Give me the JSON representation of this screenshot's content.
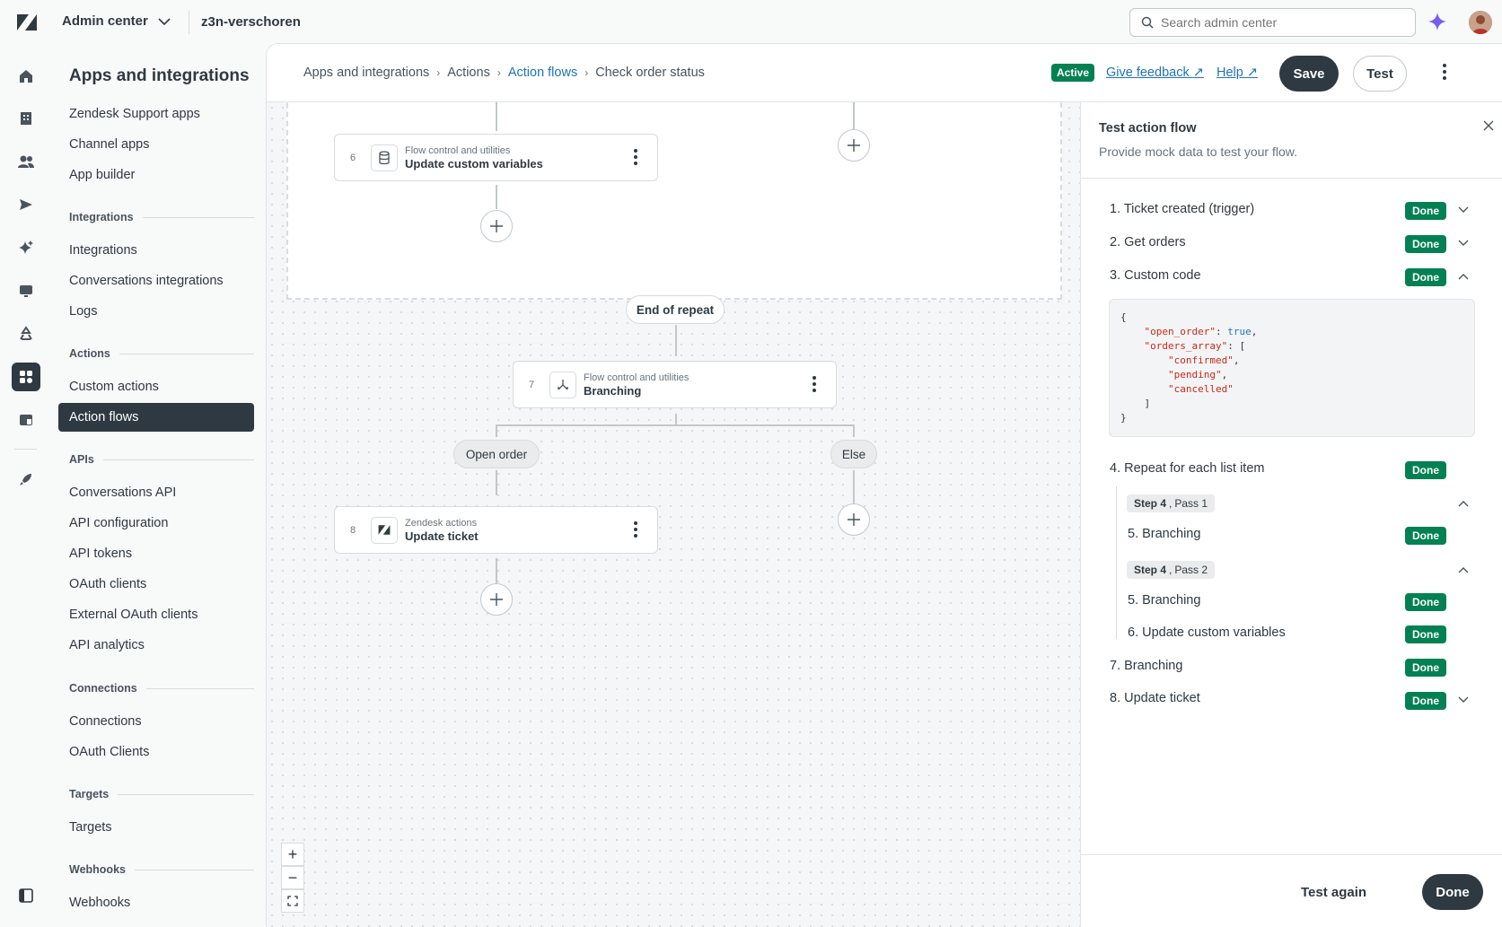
{
  "topbar": {
    "product": "Admin center",
    "account": "z3n-verschoren",
    "search_placeholder": "Search admin center"
  },
  "rail": {
    "icons": [
      "home-icon",
      "building-icon",
      "people-icon",
      "send-icon",
      "sparkle-icon",
      "monitor-icon",
      "recycle-icon",
      "apps-icon",
      "objects-icon",
      "rocket-icon",
      "sidebar-toggle-icon"
    ]
  },
  "sidebar": {
    "title": "Apps and integrations",
    "items_top": [
      "Zendesk Support apps",
      "Channel apps",
      "App builder"
    ],
    "groups": [
      {
        "label": "Integrations",
        "items": [
          "Integrations",
          "Conversations integrations",
          "Logs"
        ]
      },
      {
        "label": "Actions",
        "items": [
          "Custom actions",
          "Action flows"
        ]
      },
      {
        "label": "APIs",
        "items": [
          "Conversations API",
          "API configuration",
          "API tokens",
          "OAuth clients",
          "External OAuth clients",
          "API analytics"
        ]
      },
      {
        "label": "Connections",
        "items": [
          "Connections",
          "OAuth Clients"
        ]
      },
      {
        "label": "Targets",
        "items": [
          "Targets"
        ]
      },
      {
        "label": "Webhooks",
        "items": [
          "Webhooks"
        ]
      }
    ],
    "active_item": "Action flows"
  },
  "header": {
    "breadcrumb": [
      "Apps and integrations",
      "Actions",
      "Action flows",
      "Check order status"
    ],
    "status": "Active",
    "feedback": "Give feedback",
    "help": "Help",
    "save": "Save",
    "test": "Test"
  },
  "canvas": {
    "nodes": [
      {
        "num": "6",
        "category": "Flow control and utilities",
        "name": "Update custom variables",
        "icon": "database-icon"
      },
      {
        "num": "7",
        "category": "Flow control and utilities",
        "name": "Branching",
        "icon": "branch-icon"
      },
      {
        "num": "8",
        "category": "Zendesk actions",
        "name": "Update ticket",
        "icon": "zendesk-icon"
      }
    ],
    "end_repeat": "End of repeat",
    "branch_open": "Open order",
    "branch_else": "Else",
    "zoom": [
      "+",
      "−"
    ]
  },
  "test_panel": {
    "title": "Test action flow",
    "subtitle": "Provide mock data to test your flow.",
    "steps": [
      {
        "label": "1. Ticket created (trigger)",
        "status": "Done",
        "chevron": "down"
      },
      {
        "label": "2. Get orders",
        "status": "Done",
        "chevron": "down"
      },
      {
        "label": "3. Custom code",
        "status": "Done",
        "chevron": "up"
      },
      {
        "label": "4. Repeat for each list item",
        "status": "Done"
      },
      {
        "label": "7. Branching",
        "status": "Done"
      },
      {
        "label": "8. Update ticket",
        "status": "Done",
        "chevron": "down"
      }
    ],
    "code": {
      "open_brace": "{",
      "key1": "\"open_order\"",
      "val1": "true",
      "key2": "\"orders_array\"",
      "arr": [
        "\"confirmed\"",
        "\"pending\"",
        "\"cancelled\""
      ],
      "close_bracket": "]",
      "close_brace": "}"
    },
    "passes": [
      {
        "step": "Step 4",
        "pass": "Pass 1",
        "items": [
          {
            "label": "5. Branching",
            "status": "Done"
          }
        ]
      },
      {
        "step": "Step 4",
        "pass": "Pass 2",
        "items": [
          {
            "label": "5. Branching",
            "status": "Done"
          },
          {
            "label": "6. Update custom variables",
            "status": "Done"
          }
        ]
      }
    ],
    "test_again": "Test again",
    "done": "Done"
  },
  "colors": {
    "success": "#038153",
    "dark": "#2f3941",
    "link": "#1f73b7",
    "ai_accent": "#8b5cf6"
  }
}
